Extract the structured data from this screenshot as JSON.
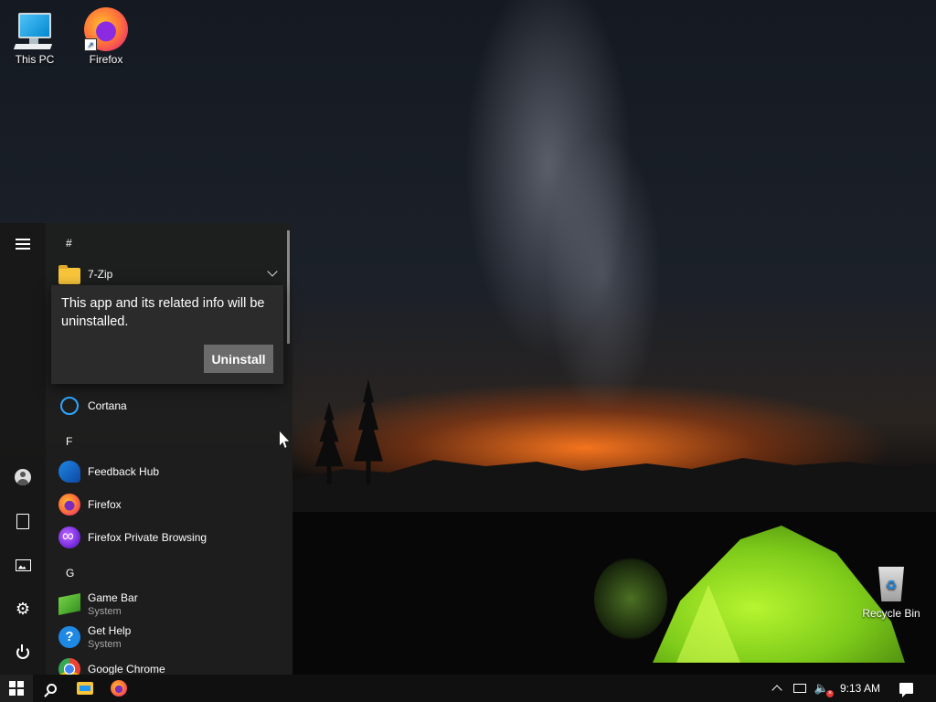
{
  "desktop": {
    "icons": [
      {
        "label": "This PC",
        "icon": "this-pc-icon"
      },
      {
        "label": "Firefox",
        "icon": "firefox-icon"
      },
      {
        "label": "Recycle Bin",
        "icon": "recycle-bin-icon"
      }
    ]
  },
  "start_menu": {
    "rail": {
      "menu": "hamburger-icon",
      "account": "user-icon",
      "documents": "document-icon",
      "pictures": "pictures-icon",
      "settings": "gear-icon",
      "power": "power-icon"
    },
    "sections": {
      "hash": "#",
      "f": "F",
      "g": "G"
    },
    "apps": {
      "seven_zip": {
        "name": "7-Zip"
      },
      "cortana": {
        "name": "Cortana"
      },
      "feedback_hub": {
        "name": "Feedback Hub"
      },
      "firefox": {
        "name": "Firefox"
      },
      "firefox_private": {
        "name": "Firefox Private Browsing"
      },
      "game_bar": {
        "name": "Game Bar",
        "sub": "System"
      },
      "get_help": {
        "name": "Get Help",
        "sub": "System"
      },
      "google_chrome": {
        "name": "Google Chrome"
      }
    },
    "uninstall_flyout": {
      "message": "This app and its related info will be uninstalled.",
      "button": "Uninstall"
    }
  },
  "taskbar": {
    "clock": "9:13 AM"
  },
  "colors": {
    "menu_bg": "#1e1e1e",
    "flyout_bg": "#2b2b2b",
    "button_bg": "#6b6b6b",
    "taskbar_bg": "#101010",
    "cortana_accent": "#2ea8ff"
  }
}
